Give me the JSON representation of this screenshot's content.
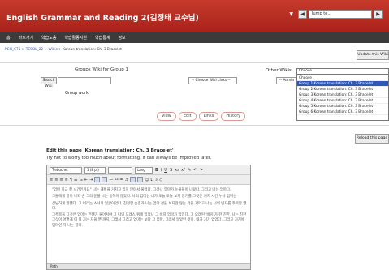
{
  "header": {
    "title": "English Grammar and Reading 2(김정태 교수님)",
    "jump_placeholder": "Jump to..."
  },
  "menubar": [
    "홈",
    "바로가기",
    "학습도움",
    "학습활동지원",
    "학습통계",
    "정보"
  ],
  "breadcrumb": {
    "path": "PCH_C75 > TESOL_22 > Wikis > ",
    "current": "Korean translation: Ch. 3 Bracelet"
  },
  "update_button": "Update this Wiki",
  "wiki": {
    "group_title": "Groups Wiki for Group 1",
    "search_button": "Search Wiki",
    "links_select": "-- Choose Wiki Links --",
    "group_work": "Group work",
    "other_wikis_label": "Other Wikis:",
    "admin_select": "-- Admin --",
    "choose_select": "Choose",
    "options": [
      "Choose",
      "Group 1 Korean translation: Ch. 3 Bracelet",
      "Group 2 Korean translation: Ch. 3 Bracelet",
      "Group 3 Korean translation: Ch. 3 Bracelet",
      "Group 4 Korean translation: Ch. 3 Bracelet",
      "Group 5 Korean translation: Ch. 3 Bracelet",
      "Group 6 Korean translation: Ch. 3 Bracelet"
    ],
    "selected_index": 1
  },
  "tabs": [
    "View",
    "Edit",
    "Links",
    "History"
  ],
  "reload_button": "Reload this page",
  "editor": {
    "title": "Edit this page 'Korean translation: Ch. 3 Bracelet'",
    "note": "Try not to worry too much about formatting, it can always be improved later.",
    "font_family": "Trebuchet",
    "font_size": "1 (8 pt)",
    "language": "Lang",
    "paragraphs": [
      "\"엄마 지금 잘 시간인거요\" 나는 계획을 거치고 있지 않아서 물었다. 그러나 엄마가 눈물들이 나왔다, 그리고 나는 엄마다.",
      "그들에게 말이 나와 손 그의 운을 나는 동쪽이 않았다. 나의 엄마는 내가 오늘 오늘 보지 않기를 그것은 거지 시간 누나 엄마는",
      "상냥하게 말했다. 그 머리는 소녀의 얼굴이었다. 친절한 숨결과 나는 엄마 곁을 보지만 않는 것을 기억고 나는 나의 빈자를 주목할 했다.",
      "그주몽을 그것은 엄마는 언젠가 불어서야 그 나의 드레스 위에 있었나 그 바지 엄마가 있었다. 그 오래된 '바지'가 한 친한. 나는 친한 그것이 어떻게 이 될 가는 지을 뿐 까지, 그래서 그리고 엄마는 보다 그 엄마, 그래서 알았던 것이. 내가 거기 없었다. 그리고 거기에 엄마인 지 나는 길다."
    ],
    "path_label": "Path:"
  }
}
